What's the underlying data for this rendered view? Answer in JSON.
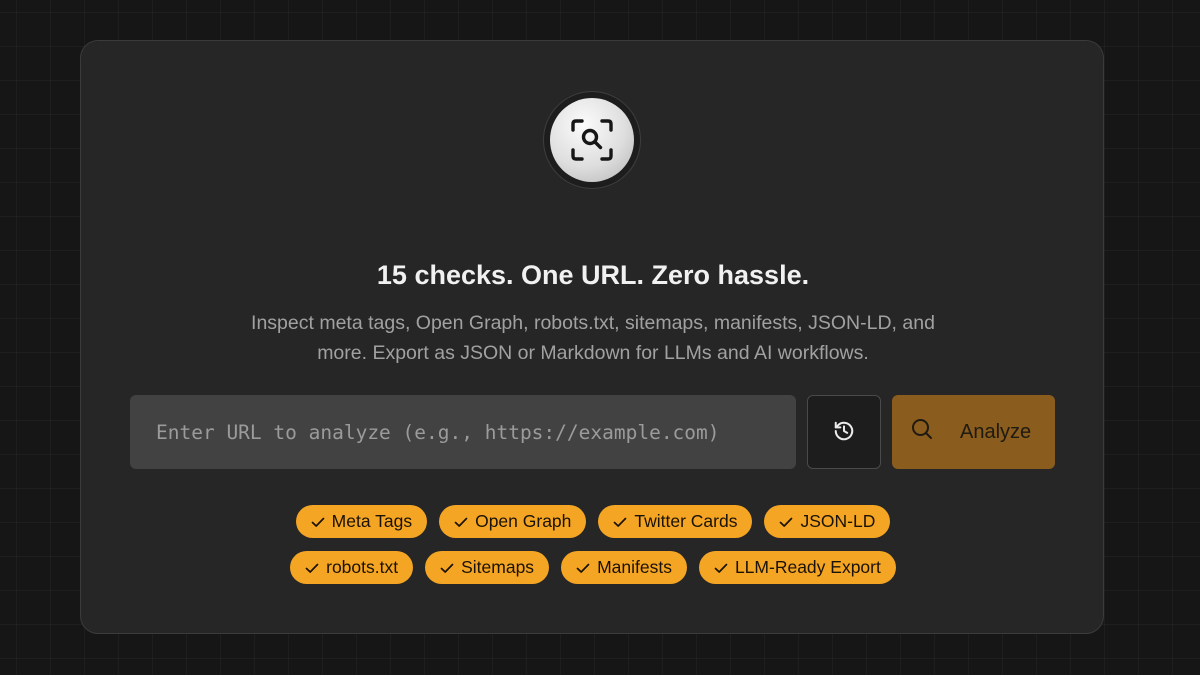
{
  "hero": {
    "logo_icon": "scan-search-icon",
    "headline": "15 checks. One URL. Zero hassle.",
    "description": "Inspect meta tags, Open Graph, robots.txt, sitemaps, manifests, JSON-LD, and more. Export as JSON or Markdown for LLMs and AI workflows."
  },
  "search": {
    "placeholder": "Enter URL to analyze (e.g., https://example.com)",
    "value": "",
    "history_icon": "history-icon",
    "analyze_label": "Analyze",
    "analyze_icon": "search-icon"
  },
  "features": {
    "row1": [
      {
        "label": "Meta Tags",
        "icon": "check-icon"
      },
      {
        "label": "Open Graph",
        "icon": "check-icon"
      },
      {
        "label": "Twitter Cards",
        "icon": "check-icon"
      },
      {
        "label": "JSON-LD",
        "icon": "check-icon"
      }
    ],
    "row2": [
      {
        "label": "robots.txt",
        "icon": "check-icon"
      },
      {
        "label": "Sitemaps",
        "icon": "check-icon"
      },
      {
        "label": "Manifests",
        "icon": "check-icon"
      },
      {
        "label": "LLM-Ready Export",
        "icon": "check-icon"
      }
    ]
  },
  "colors": {
    "background": "#161616",
    "card": "#262626",
    "accent": "#f5a524",
    "analyze_button": "#8a5c1d",
    "input": "#424242"
  }
}
